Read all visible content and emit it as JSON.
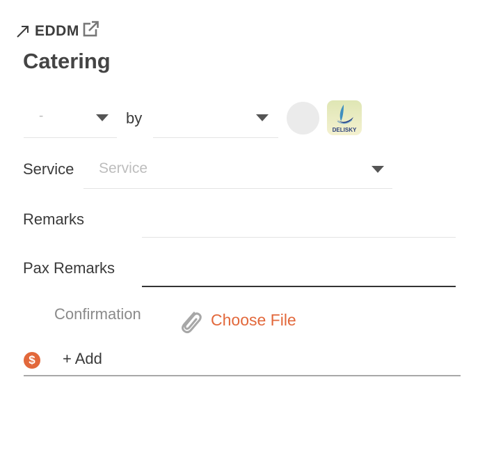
{
  "breadcrumb": {
    "label": "EDDM"
  },
  "title": "Catering",
  "row1": {
    "status_value": "-",
    "by_label": "by",
    "vendor_value": "",
    "logo_text": "DELISKY"
  },
  "service": {
    "label": "Service",
    "placeholder": "Service"
  },
  "remarks": {
    "label": "Remarks",
    "value": ""
  },
  "pax_remarks": {
    "label": "Pax Remarks",
    "value": ""
  },
  "confirmation": {
    "label": "Confirmation",
    "choose_file": "Choose File"
  },
  "add_row": {
    "currency_symbol": "$",
    "add_label": "+ Add"
  },
  "colors": {
    "accent": "#e2683b",
    "muted": "#bdbdbd",
    "underline": "#e3e3e3"
  },
  "icons": [
    "arrow-up-right-icon",
    "external-link-icon",
    "caret-down-icon",
    "paperclip-icon",
    "dollar-icon"
  ]
}
